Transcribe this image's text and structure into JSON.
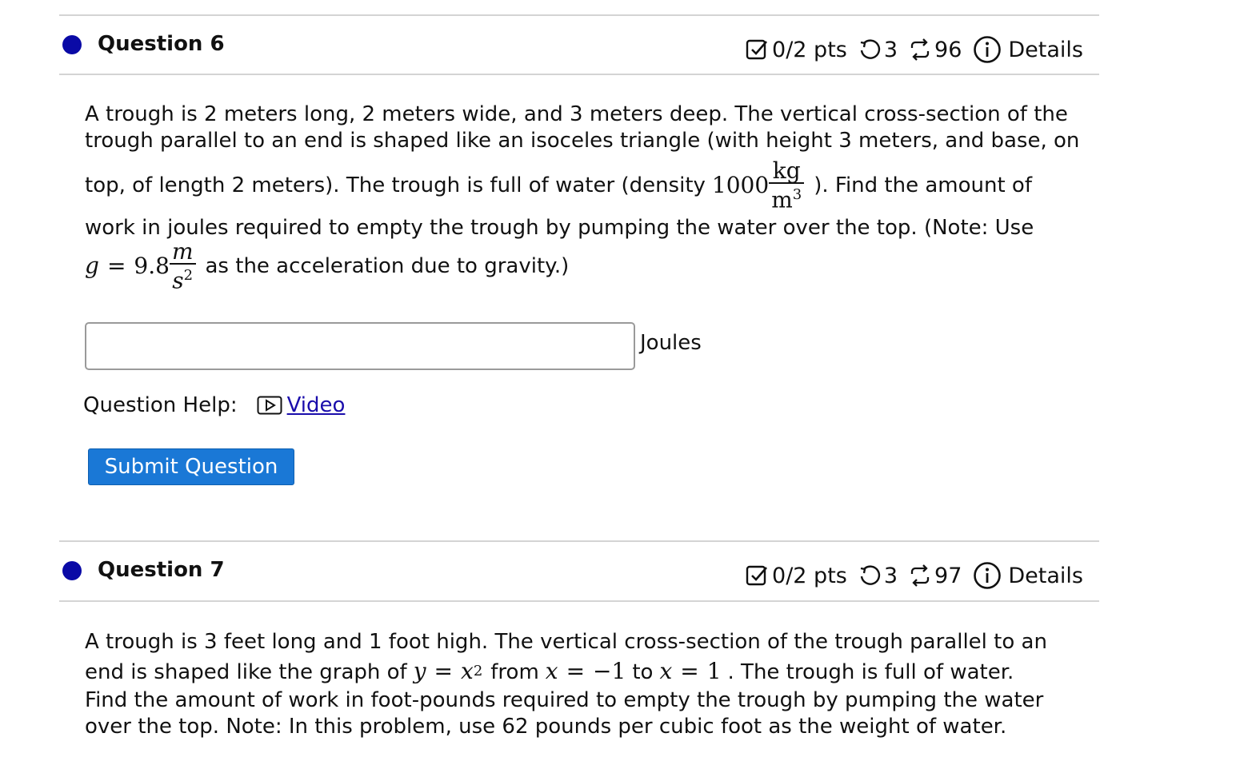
{
  "questions": [
    {
      "title": "Question 6",
      "points": "0/2 pts",
      "attempts": "3",
      "versions": "96",
      "details_label": "Details",
      "text": {
        "l1": "A trough is 2 meters long, 2 meters wide, and 3 meters deep. The vertical cross-section of the",
        "l2": "trough parallel to an end is shaped like an isoceles triangle (with height 3 meters, and base, on",
        "l3a": "top, of length 2 meters). The trough is full of water (density",
        "density_value": "1000",
        "density_unit_num": "kg",
        "density_unit_den": "m",
        "density_unit_exp": "3",
        "l3b": "). Find the amount of",
        "l4": "work in joules required to empty the trough by pumping the water over the top. (Note: Use",
        "g_var": "g",
        "g_eq": "=",
        "g_value": "9.8",
        "g_unit_num": "m",
        "g_unit_den": "s",
        "g_unit_exp": "2",
        "l5b": "as the acceleration due to gravity.)"
      },
      "answer": {
        "value": "",
        "placeholder": "",
        "unit": "Joules"
      },
      "help_label": "Question Help:",
      "video_label": "Video",
      "submit_label": "Submit Question"
    },
    {
      "title": "Question 7",
      "points": "0/2 pts",
      "attempts": "3",
      "versions": "97",
      "details_label": "Details",
      "text": {
        "l1": "A trough is 3 feet long and 1 foot high. The vertical cross-section of the trough parallel to an",
        "l2a": "end is shaped like the graph of",
        "y_var": "y",
        "eq1": "=",
        "x_var": "x",
        "x_exp": "2",
        "from_word": "from",
        "x_var2": "x",
        "eq2": "=",
        "lower": "−1",
        "to_word": "to",
        "x_var3": "x",
        "eq3": "=",
        "upper": "1",
        "l2b": ". The trough is full of water.",
        "l3": "Find the amount of work in foot-pounds required to empty the trough by pumping the water",
        "l4": "over the top. Note: In this problem, use 62 pounds per cubic foot as the weight of water."
      }
    }
  ]
}
